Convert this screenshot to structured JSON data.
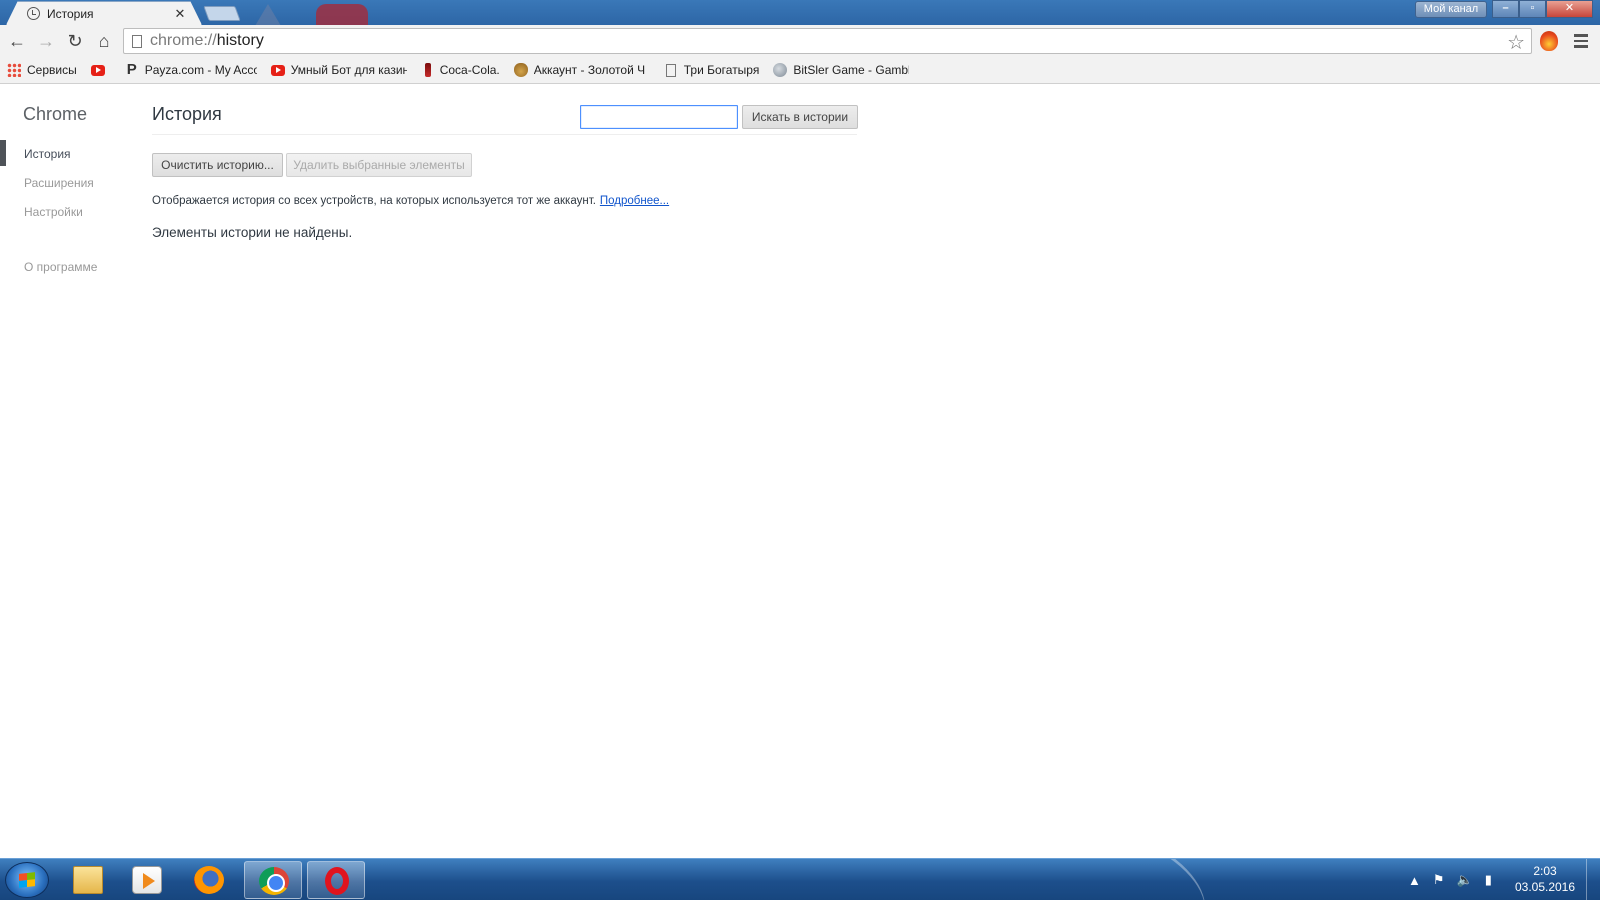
{
  "window": {
    "profile_label": "Мой канал",
    "controls": {
      "minimize": "–",
      "maximize": "▫",
      "close": "✕"
    }
  },
  "tabs": [
    {
      "title": "История",
      "active": true,
      "close": "✕"
    }
  ],
  "toolbar": {
    "back": "←",
    "forward": "→",
    "reload": "↻",
    "home": "⌂",
    "url_scheme": "chrome://",
    "url_path": "history",
    "star": "☆"
  },
  "bookmarks": [
    {
      "label": "Сервисы",
      "icon": "apps-grid-icon"
    },
    {
      "label": "",
      "icon": "youtube-icon"
    },
    {
      "label": "Payza.com - My Acco",
      "icon": "payza-icon"
    },
    {
      "label": "Умный Бот для казин",
      "icon": "youtube-icon"
    },
    {
      "label": "Coca-Cola.",
      "icon": "bottle-icon"
    },
    {
      "label": "Аккаунт - Золотой Ч",
      "icon": "money-bag-icon"
    },
    {
      "label": "Три Богатыря",
      "icon": "page-icon"
    },
    {
      "label": "BitSler Game - Gambl",
      "icon": "globe-icon"
    }
  ],
  "sidebar": {
    "brand": "Chrome",
    "items": [
      {
        "label": "История",
        "active": true
      },
      {
        "label": "Расширения",
        "active": false
      },
      {
        "label": "Настройки",
        "active": false
      }
    ],
    "about": "О программе"
  },
  "main": {
    "title": "История",
    "search_value": "",
    "search_button": "Искать в истории",
    "clear_button": "Очистить историю...",
    "remove_button": "Удалить выбранные элементы",
    "sync_note": "Отображается история со всех устройств, на которых используется тот же аккаунт.",
    "sync_link": "Подробнее...",
    "no_results": "Элементы истории не найдены."
  },
  "taskbar": {
    "apps": [
      {
        "name": "explorer",
        "icon": "folder-icon",
        "active": false
      },
      {
        "name": "media-player",
        "icon": "media-player-icon",
        "active": false
      },
      {
        "name": "firefox",
        "icon": "firefox-icon",
        "active": false
      },
      {
        "name": "chrome",
        "icon": "chrome-icon",
        "active": true
      },
      {
        "name": "opera",
        "icon": "opera-icon",
        "active": true
      }
    ],
    "tray_icons": [
      "up-arrow-icon",
      "flag-icon",
      "volume-icon",
      "signal-icon"
    ],
    "time": "2:03",
    "date": "03.05.2016"
  },
  "colors": {
    "link": "#1155cc",
    "focus_border": "#4d90fe",
    "sidebar_marker": "#4e5358",
    "taskbar": "#1d4f8c"
  }
}
